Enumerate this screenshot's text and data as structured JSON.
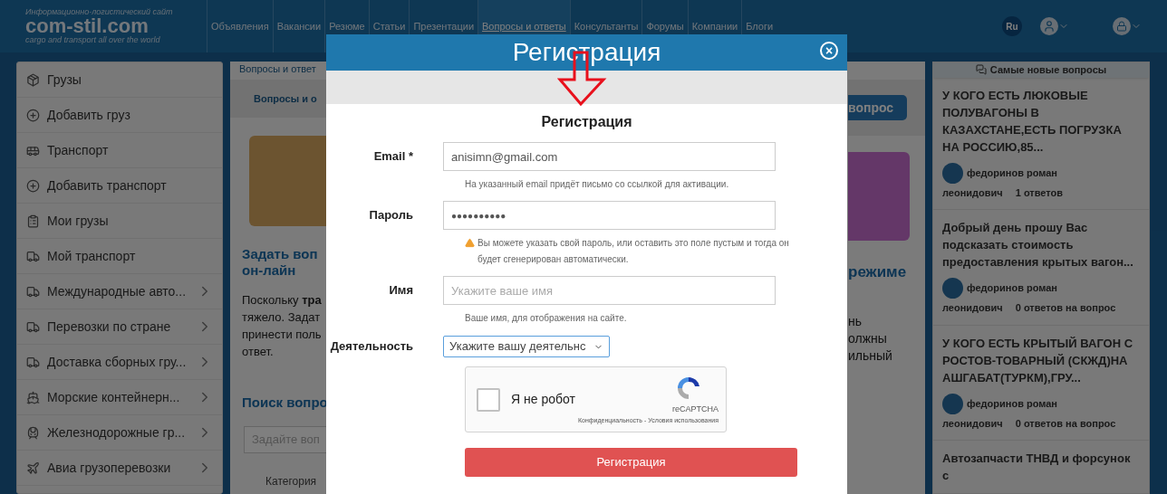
{
  "header": {
    "tagline_top": "Информационно-логистический сайт",
    "logo": "com-stil.com",
    "tagline_bottom": "cargo and transport all over the world",
    "nav": [
      {
        "label": "Объявления",
        "selected": false
      },
      {
        "label": "Вакансии",
        "selected": false
      },
      {
        "label": "Резюме",
        "selected": false
      },
      {
        "label": "Статьи",
        "selected": false
      },
      {
        "label": "Презентации",
        "selected": false
      },
      {
        "label": "Вопросы и ответы",
        "selected": true
      },
      {
        "label": "Консультанты",
        "selected": false
      },
      {
        "label": "Форумы",
        "selected": false
      },
      {
        "label": "Компании",
        "selected": false
      },
      {
        "label": "Блоги",
        "selected": false
      }
    ],
    "language": "Ru"
  },
  "sidebar": {
    "items": [
      {
        "label": "Грузы",
        "has_submenu": false
      },
      {
        "label": "Добавить груз",
        "has_submenu": false
      },
      {
        "label": "Транспорт",
        "has_submenu": false
      },
      {
        "label": "Добавить транспорт",
        "has_submenu": false
      },
      {
        "label": "Мои грузы",
        "has_submenu": false
      },
      {
        "label": "Мой транспорт",
        "has_submenu": false
      },
      {
        "label": "Международные авто...",
        "has_submenu": true
      },
      {
        "label": "Перевозки по стране",
        "has_submenu": true
      },
      {
        "label": "Доставка сборных гру...",
        "has_submenu": true
      },
      {
        "label": "Морские контейнерн...",
        "has_submenu": true
      },
      {
        "label": "Железнодорожные гр...",
        "has_submenu": true
      },
      {
        "label": "Авиа грузоперевозки",
        "has_submenu": true
      }
    ]
  },
  "content_left": {
    "breadcrumb": "Вопросы и ответ",
    "tab": "Вопросы и о",
    "heading_lines": [
      "Задать воп",
      "он-лайн"
    ],
    "paragraph_lines": [
      "Поскольку **тра**",
      "тяжело. Задат",
      "принести поль",
      "ответ."
    ],
    "search_heading": "Поиск вопро",
    "search_placeholder": "Задайте воп",
    "category_label": "Категория"
  },
  "content_right": {
    "button": "вопрос",
    "heading": "режиме",
    "paragraph_lines": [
      "нь",
      "олжны",
      "ильный"
    ]
  },
  "latest_questions": {
    "title": "Самые новые вопросы",
    "items": [
      {
        "question": "У КОГО ЕСТЬ ЛЮКОВЫЕ ПОЛУВАГОНЫ В КАЗАХСТАНЕ,ЕСТЬ ПОГРУЗКА НА РОССИЮ,85...",
        "author_lines": [
          "федоринов роман",
          "леонидович"
        ],
        "answers": "1 ответов"
      },
      {
        "question": "Добрый день прошу Вас подсказать стоимость предоставления крытых вагон...",
        "author_lines": [
          "федоринов роман",
          "леонидович"
        ],
        "answers": "0 ответов на вопрос"
      },
      {
        "question": "У КОГО ЕСТЬ КРЫТЫЙ ВАГОН С РОСТОВ-ТОВАРНЫЙ (СКЖД)НА АШГАБАТ(ТУРКМ),ГРУ...",
        "author_lines": [
          "федоринов роман",
          "леонидович"
        ],
        "answers": "0 ответов на вопрос"
      },
      {
        "question": "Автозапчасти ТНВД и форсунок с"
      }
    ]
  },
  "modal": {
    "title": "Регистрация",
    "close": "×",
    "form_title": "Регистрация",
    "email": {
      "label": "Email *",
      "value": "anisimn@gmail.com",
      "hint": "На указанный email придёт письмо со ссылкой для активации."
    },
    "password": {
      "label": "Пароль",
      "value": "●●●●●●●●●●",
      "hint": "Вы можете указать свой пароль, или оставить это поле пустым и тогда он будет сгенерирован автоматически."
    },
    "name": {
      "label": "Имя",
      "placeholder": "Укажите ваше имя",
      "hint": "Ваше имя, для отображения на сайте."
    },
    "activity": {
      "label": "Деятельность",
      "placeholder": "Укажите вашу деятельнс"
    },
    "captcha": {
      "checked": false,
      "label": "Я не робот",
      "brand": "reCAPTCHA",
      "privacy": "Конфиденциальность",
      "separator": "-",
      "terms": "Условия использования"
    },
    "submit": "Регистрация"
  }
}
